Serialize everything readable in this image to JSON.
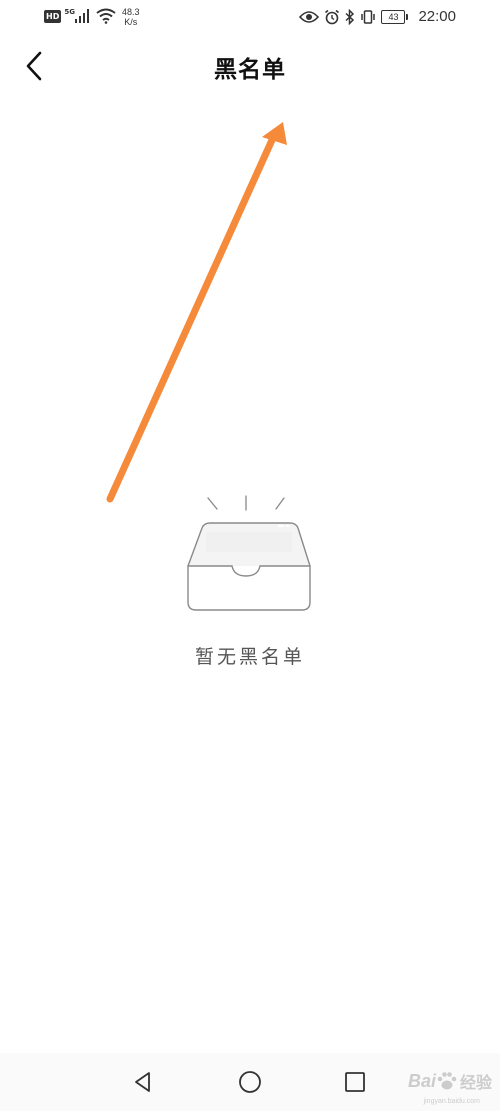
{
  "status_bar": {
    "hd": "HD",
    "network": "5G",
    "speed_value": "48.3",
    "speed_unit": "K/s",
    "battery": "43",
    "time": "22:00",
    "icons": [
      "signal-icon",
      "wifi-icon",
      "eye-icon",
      "alarm-icon",
      "bluetooth-icon",
      "vibrate-icon",
      "battery-icon"
    ]
  },
  "header": {
    "title": "黑名单",
    "back_icon": "chevron-left-icon"
  },
  "empty_state": {
    "message": "暂无黑名单",
    "illustration": "empty-box-icon"
  },
  "annotation": {
    "color": "#F58A3A"
  },
  "nav_bar": {
    "icons": [
      "nav-back-icon",
      "nav-home-icon",
      "nav-recents-icon"
    ]
  },
  "watermark": {
    "brand": "Bai",
    "suffix": "经验",
    "url": "jingyan.baidu.com"
  }
}
